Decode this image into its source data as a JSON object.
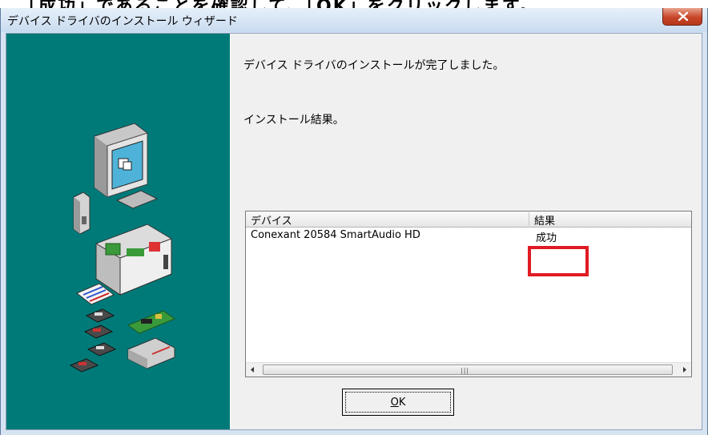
{
  "caption": {
    "text": "…「成功」であることを確認して、「OK」をクリックします。"
  },
  "window": {
    "title": "デバイス ドライバのインストール ウィザード",
    "close_icon": "close-icon"
  },
  "main": {
    "message": "デバイス ドライバのインストールが完了しました。",
    "result_label": "インストール結果。"
  },
  "list": {
    "columns": [
      "デバイス",
      "結果"
    ],
    "rows": [
      {
        "device": "Conexant 20584 SmartAudio HD",
        "result": "成功"
      }
    ],
    "highlight_color": "#e01b24"
  },
  "buttons": {
    "ok_mnemonic": "O",
    "ok_rest": "K"
  },
  "colors": {
    "side_panel": "#007a78",
    "title_bar": "#c9dbef",
    "close_button": "#c8452a"
  }
}
